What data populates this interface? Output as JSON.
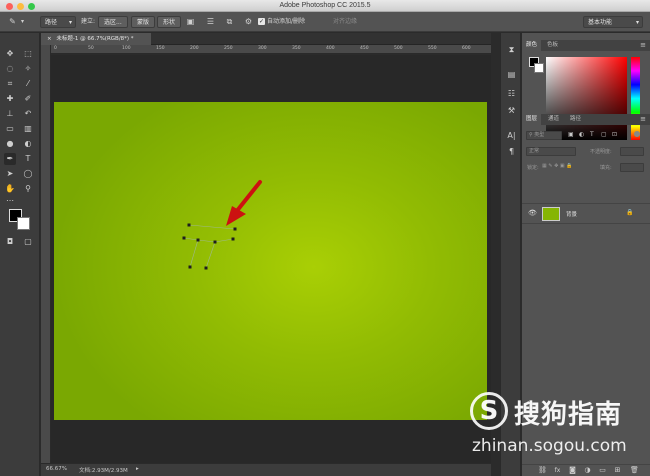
{
  "window": {
    "title": "Adobe Photoshop CC 2015.5"
  },
  "options_bar": {
    "mode_select": "路径",
    "make_label": "建立:",
    "selection_btn": "选区...",
    "mask_btn": "蒙版",
    "shape_btn": "形状",
    "auto_add_delete_label": "自动添加/删除",
    "align_edges_label": "对齐边缘",
    "workspace_select": "基本功能"
  },
  "document": {
    "tab_title": "未标题-1 @ 66.7%(RGB/8*) *",
    "ruler_ticks": [
      "0",
      "50",
      "100",
      "150",
      "200",
      "250",
      "300",
      "350",
      "400",
      "450",
      "500",
      "550",
      "600",
      "650"
    ],
    "zoom": "66.67%",
    "doc_info": "文档:2.93M/2.93M",
    "canvas_color": "#8cb903"
  },
  "panels": {
    "color_tabs": [
      "颜色",
      "色板"
    ],
    "layer_tabs": [
      "图层",
      "通道",
      "路径"
    ],
    "kind_filter": "类型",
    "blend_mode": "正常",
    "opacity_label": "不透明度:",
    "lock_label": "锁定:",
    "fill_label": "填充:",
    "layer_name": "背景"
  },
  "watermark": {
    "logo_letter": "S",
    "brand": "搜狗指南",
    "url": "zhinan.sogou.com"
  },
  "colors": {
    "arrow": "#cc1111",
    "accent": "#8cb903"
  }
}
